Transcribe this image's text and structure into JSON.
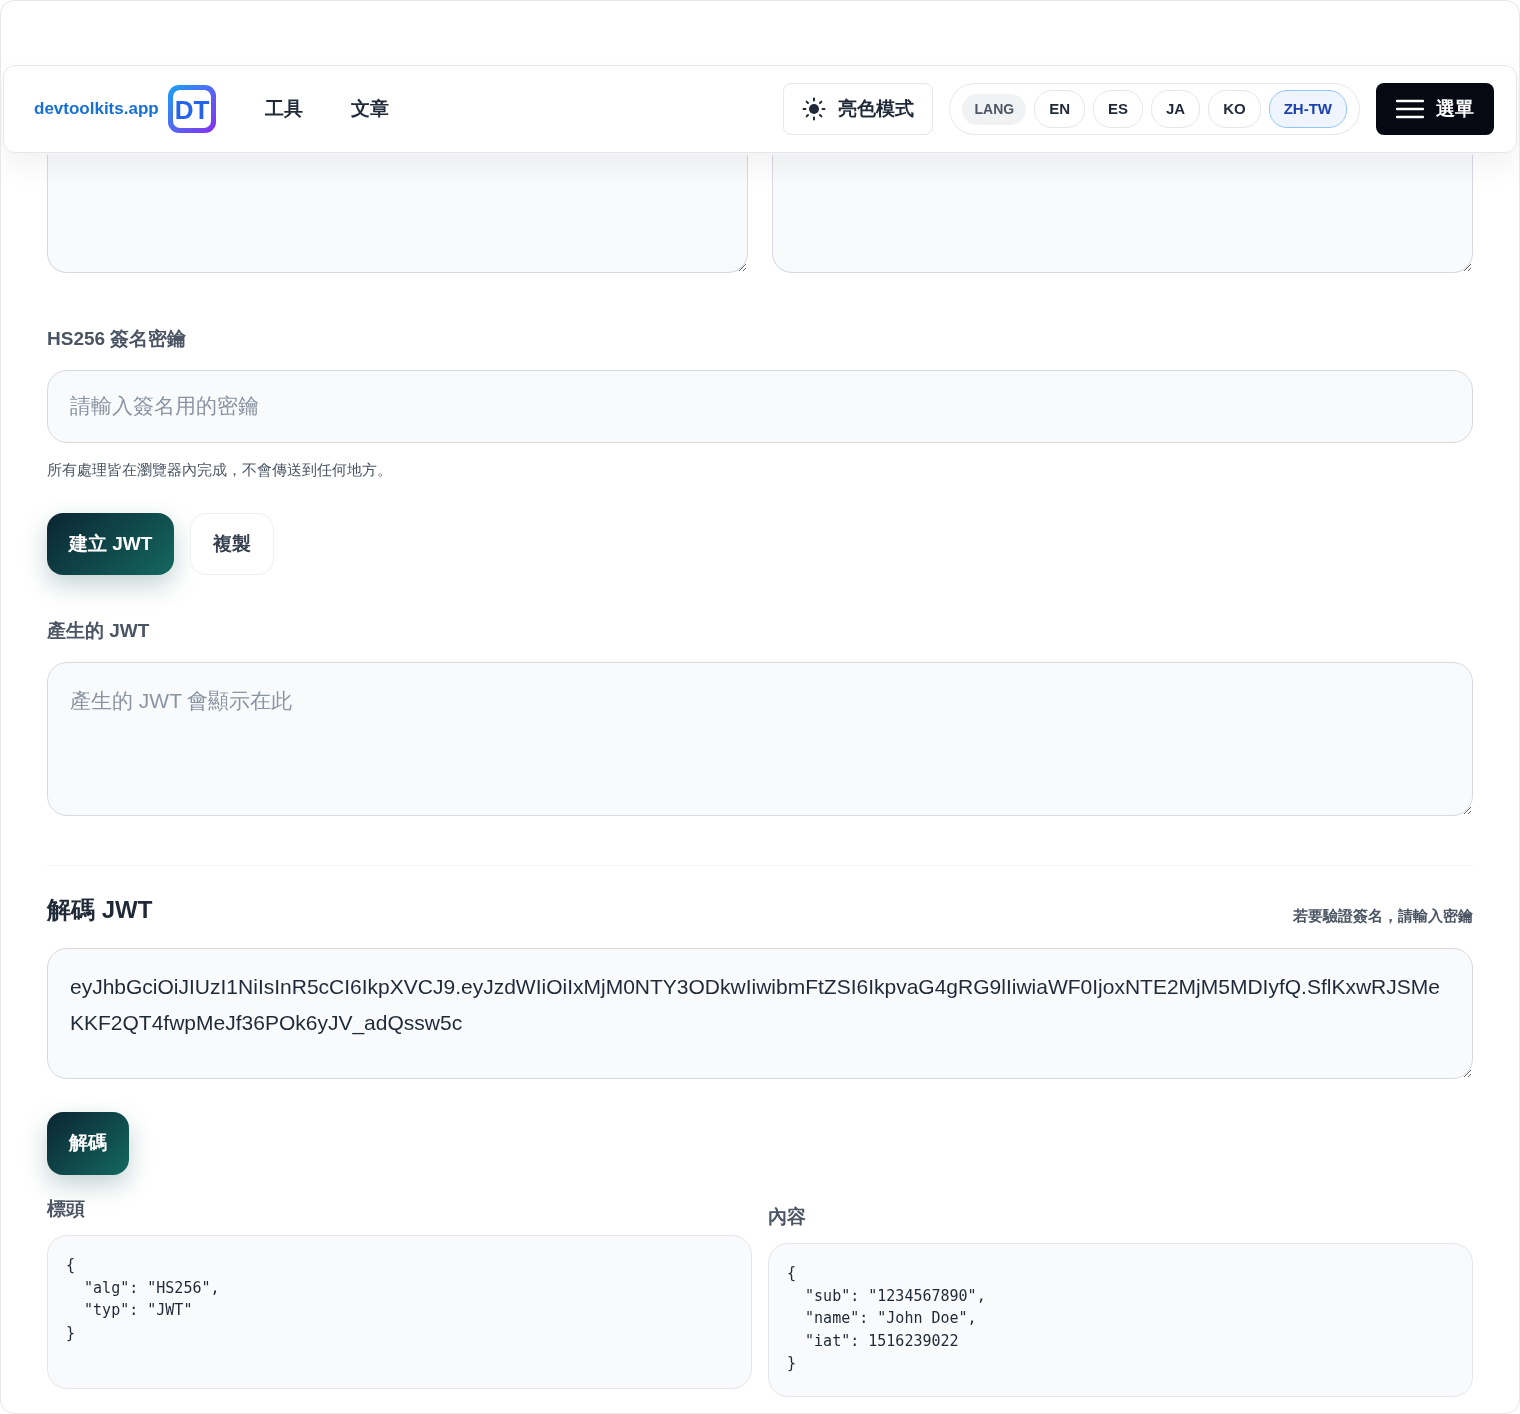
{
  "navbar": {
    "brand": "devtoolkits.app",
    "logo_text": "DT",
    "links": [
      {
        "label": "工具"
      },
      {
        "label": "文章"
      }
    ],
    "theme_toggle": "亮色模式",
    "lang_label": "LANG",
    "languages": [
      {
        "label": "EN",
        "selected": false
      },
      {
        "label": "ES",
        "selected": false
      },
      {
        "label": "JA",
        "selected": false
      },
      {
        "label": "KO",
        "selected": false
      },
      {
        "label": "ZH-TW",
        "selected": true
      }
    ],
    "menu_button": "選單"
  },
  "encoder": {
    "secret_label": "HS256 簽名密鑰",
    "secret_placeholder": "請輸入簽名用的密鑰",
    "hint": "所有處理皆在瀏覽器內完成，不會傳送到任何地方。",
    "buttons": [
      {
        "label": "建立 JWT",
        "kind": "primary"
      },
      {
        "label": "複製",
        "kind": "secondary"
      }
    ],
    "output_label": "產生的 JWT",
    "output_placeholder": "產生的 JWT 會顯示在此"
  },
  "decoder": {
    "title": "解碼 JWT",
    "hint": "若要驗證簽名，請輸入密鑰",
    "token": "eyJhbGciOiJIUzI1NiIsInR5cCI6IkpXVCJ9.eyJzdWIiOiIxMjM0NTY3ODkwIiwibmFtZSI6IkpvaG4gRG9lIiwiaWF0IjoxNTE2MjM5MDIyfQ.SflKxwRJSMeKKF2QT4fwpMeJf36POk6yJV_adQssw5c",
    "button": "解碼",
    "header_label": "標頭",
    "header_json": "{\n  \"alg\": \"HS256\",\n  \"typ\": \"JWT\"\n}",
    "payload_label": "內容",
    "payload_json": "{\n  \"sub\": \"1234567890\",\n  \"name\": \"John Doe\",\n  \"iat\": 1516239022\n}"
  }
}
